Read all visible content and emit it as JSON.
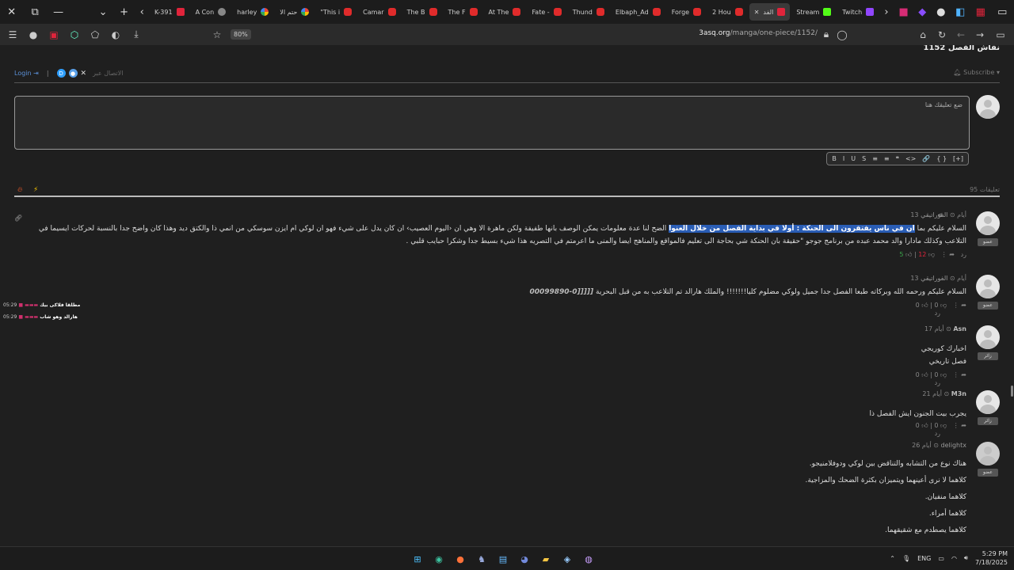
{
  "tabs": [
    {
      "label": "K-391",
      "favicon": "red"
    },
    {
      "label": "A Con",
      "favicon": "gray"
    },
    {
      "label": "harley",
      "favicon": "g"
    },
    {
      "label": "حتم الا",
      "favicon": "g"
    },
    {
      "label": "\"This i",
      "favicon": "yt"
    },
    {
      "label": "Camar",
      "favicon": "yt"
    },
    {
      "label": "The B",
      "favicon": "yt"
    },
    {
      "label": "The F",
      "favicon": "yt"
    },
    {
      "label": "At The",
      "favicon": "yt"
    },
    {
      "label": "Fate -",
      "favicon": "yt"
    },
    {
      "label": "Thund",
      "favicon": "yt"
    },
    {
      "label": "Elbaph_Ad",
      "favicon": "yt"
    },
    {
      "label": "Forge",
      "favicon": "yt"
    },
    {
      "label": "2 Hou",
      "favicon": "yt"
    },
    {
      "label": "الفد",
      "favicon": "red",
      "active": true
    },
    {
      "label": "Stream",
      "favicon": "green"
    },
    {
      "label": "Twitch",
      "favicon": "purple"
    }
  ],
  "toolbar": {
    "zoom": "80%",
    "url_domain": "3asq.org",
    "url_path": "/manga/one-piece/1152/"
  },
  "page": {
    "chapter_title": "نقاش الفصل 1152",
    "login_label": "Login",
    "connect_label": "الاتصال عبر",
    "subscribe_label": "Subscribe",
    "editor_placeholder": "ضع تعليقك هنا",
    "format_buttons": [
      "B",
      "I",
      "U",
      "S",
      "≡",
      "≡",
      "❝",
      "<>",
      "🔗",
      "{ }",
      "[+]"
    ],
    "comment_count": "95 تعليقات"
  },
  "comments": [
    {
      "author": "الفوراتيقي",
      "time": "13 أيام",
      "badge": "عضو",
      "line1_pre": "السلام عليكم بما",
      "line1_hl": "ان في ناس يفتقرون الى الحنكة : أولا في بداية الفصل من خلال العنوا",
      "line1_post": "الضح لنا عدة معلومات يمكن الوصف بانها طفيفة ولكن ماهرة الا وهي ان ‹اليوم العصيب› ان كان يدل على شيء فهو ان لوكي ام ايزن سوسكي من انمي ذا والكتق ديد وهذا كان واضح جدا بالنسبة لحركات ايسيما في",
      "line2": "التلاعب وكذلك مادارا والد محمد عبده من برنامج جوجو \"حقيقة بان الحنكة شي بحاجة الى تعليم فالمواقع والمناهج ايضا والمنى ما اعرمتم في التصريه هذا شيء بسيط جدا وشكرا حبايب قلبي .",
      "up": "5",
      "down": "12",
      "reply": "رد"
    },
    {
      "author": "الفوراتيقي",
      "time": "13 أيام",
      "badge": "عضو",
      "line1_pre": "السلام عليكم ورحمه الله وبركاته طبعا الفصل جدا جميل ولوكي مضلوم كليا!!!!!!! والملك هارالد تم التلاعب به من قبل البحرية",
      "line1_hl": "",
      "line1_post": "[[[[[0-00099890",
      "line2": "",
      "up": "0",
      "down": "0",
      "reply": "رد"
    },
    {
      "author": "Asn",
      "time": "17 أيام",
      "badge": "زائر",
      "lines": [
        "اخبارك كوريجي",
        "فصل تاريخي"
      ],
      "up": "0",
      "down": "0",
      "reply": "رد"
    },
    {
      "author": "M3n",
      "time": "21 أيام",
      "badge": "زائر",
      "lines": [
        "يجرب بيت الجنون ايش الفصل ذا"
      ],
      "up": "0",
      "down": "0",
      "reply": "رد"
    },
    {
      "author": "delightx",
      "time": "26 أيام",
      "badge": "عضو",
      "lines": [
        "هناك نوع من التشابه والتناقض بين لوكي ودوفلامنيجو.",
        "كلاهما لا نرى أعينهما ويتميزان بكثرة الضحك والمزاجية.",
        "كلاهما منفيان.",
        "كلاهما أمراء.",
        "كلاهما يصطدم مع شقيقهما."
      ]
    }
  ],
  "side_notes": [
    {
      "text": "مطلقا فلاكى بيك",
      "time": "05:29"
    },
    {
      "text": "هارالد وهو شاب",
      "time": "05:29"
    }
  ],
  "taskbar": {
    "lang": "ENG",
    "time": "5:29 PM",
    "date": "7/18/2025"
  }
}
